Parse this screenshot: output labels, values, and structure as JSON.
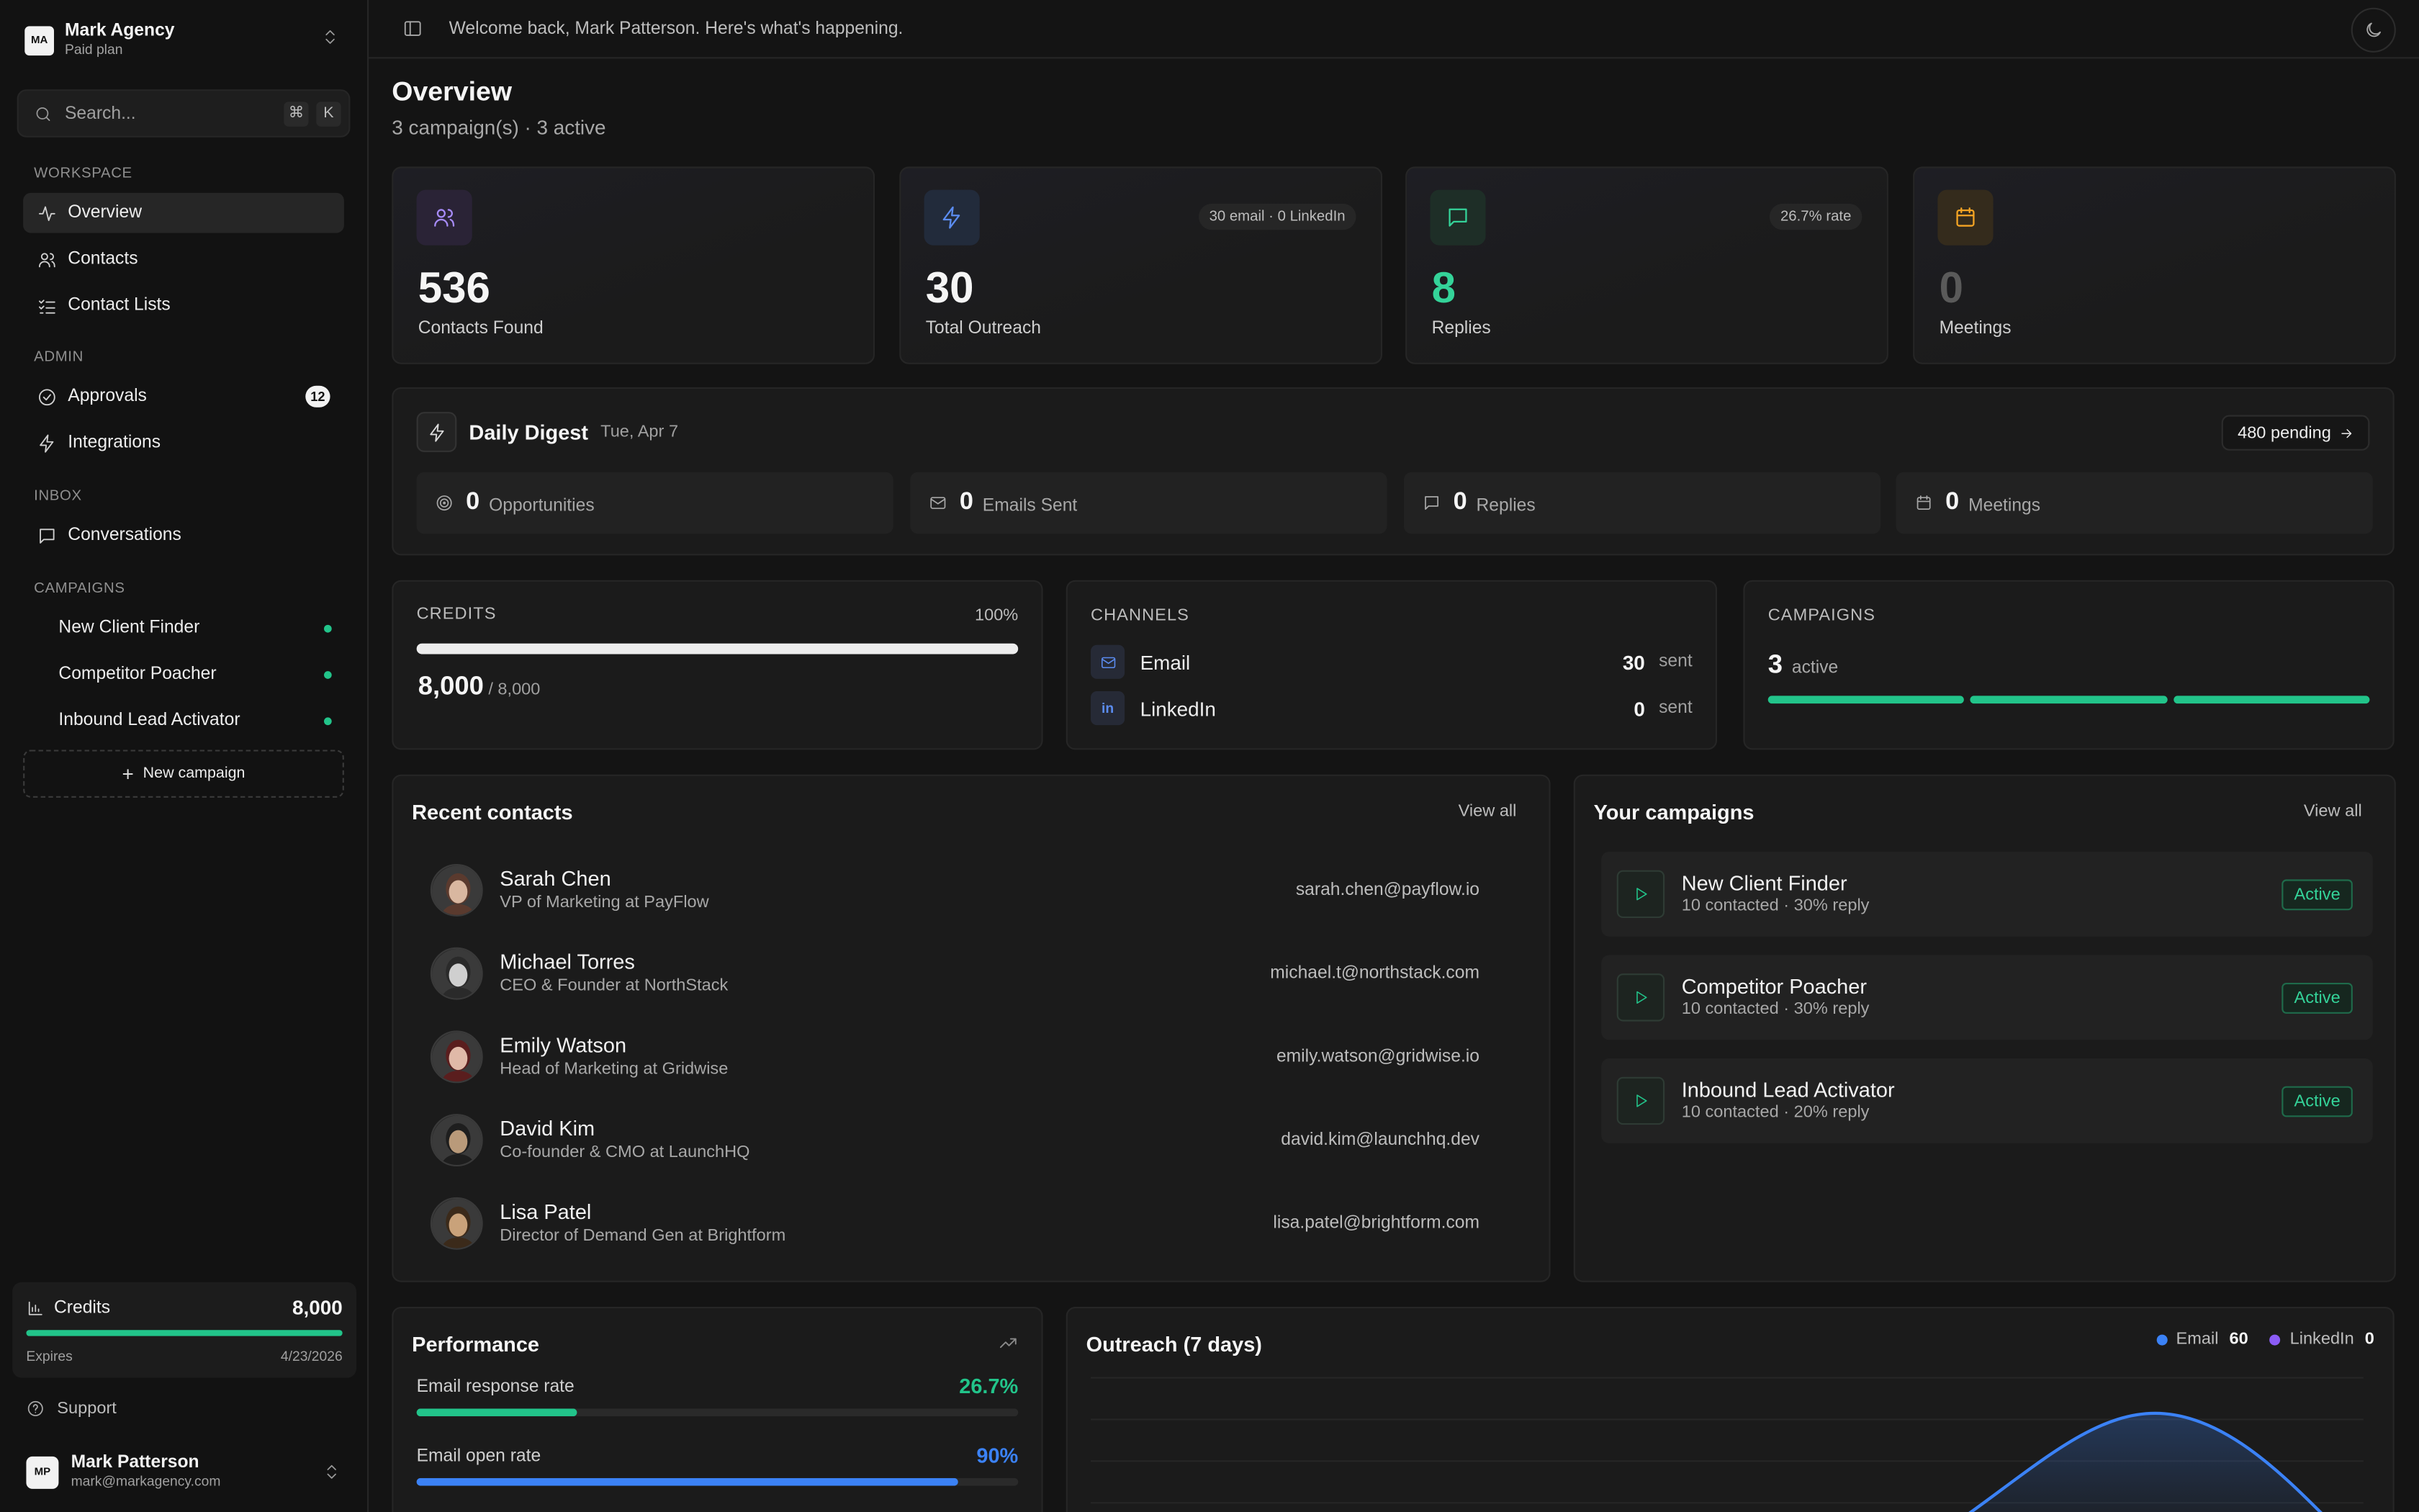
{
  "org": {
    "initials": "MA",
    "name": "Mark Agency",
    "plan": "Paid plan"
  },
  "search": {
    "placeholder": "Search...",
    "shortcut_mod": "⌘",
    "shortcut_key": "K"
  },
  "sidebar": {
    "workspace_label": "WORKSPACE",
    "workspace": [
      {
        "label": "Overview",
        "icon": "activity-icon"
      },
      {
        "label": "Contacts",
        "icon": "users-icon"
      },
      {
        "label": "Contact Lists",
        "icon": "list-checks-icon"
      }
    ],
    "admin_label": "ADMIN",
    "admin": [
      {
        "label": "Approvals",
        "icon": "check-circle-icon",
        "badge": "12"
      },
      {
        "label": "Integrations",
        "icon": "bolt-icon"
      }
    ],
    "inbox_label": "INBOX",
    "inbox": [
      {
        "label": "Conversations",
        "icon": "message-icon"
      }
    ],
    "campaigns_label": "CAMPAIGNS",
    "campaigns": [
      {
        "label": "New Client Finder"
      },
      {
        "label": "Competitor Poacher"
      },
      {
        "label": "Inbound Lead Activator"
      }
    ],
    "new_campaign": "New campaign",
    "credits": {
      "title": "Credits",
      "value": "8,000",
      "expires_label": "Expires",
      "expires_date": "4/23/2026",
      "fill": 1.0
    },
    "support": "Support",
    "user": {
      "initials": "MP",
      "name": "Mark Patterson",
      "email": "mark@markagency.com"
    }
  },
  "topbar": {
    "welcome": "Welcome back, Mark Patterson. Here's what's happening."
  },
  "page": {
    "title": "Overview",
    "subtitle": "3 campaign(s) · 3 active"
  },
  "stats": [
    {
      "value": "536",
      "label": "Contacts Found",
      "pill": "",
      "color": "#f5f5f5",
      "icon_bg": "#2a2336",
      "icon_color": "#a78bfa"
    },
    {
      "value": "30",
      "label": "Total Outreach",
      "pill": "30 email · 0 LinkedIn",
      "color": "#f5f5f5",
      "icon_bg": "#222b3b",
      "icon_color": "#5b8cf0"
    },
    {
      "value": "8",
      "label": "Replies",
      "pill": "26.7% rate",
      "color": "#34d399",
      "icon_bg": "#1e2e27",
      "icon_color": "#34d399"
    },
    {
      "value": "0",
      "label": "Meetings",
      "pill": "",
      "color": "#5a5a5a",
      "icon_bg": "#342b1c",
      "icon_color": "#f5a524"
    }
  ],
  "digest": {
    "title": "Daily Digest",
    "date": "Tue, Apr 7",
    "pending": "480 pending",
    "tiles": [
      {
        "num": "0",
        "label": "Opportunities",
        "icon": "target-icon"
      },
      {
        "num": "0",
        "label": "Emails Sent",
        "icon": "mail-icon"
      },
      {
        "num": "0",
        "label": "Replies",
        "icon": "message-icon"
      },
      {
        "num": "0",
        "label": "Meetings",
        "icon": "calendar-icon"
      }
    ]
  },
  "credits_card": {
    "label": "CREDITS",
    "pct": "100%",
    "value": "8,000",
    "total": "/ 8,000",
    "fill": 1.0
  },
  "channels": {
    "label": "CHANNELS",
    "rows": [
      {
        "name": "Email",
        "num": "30",
        "unit": "sent"
      },
      {
        "name": "LinkedIn",
        "num": "0",
        "unit": "sent"
      }
    ]
  },
  "campaigns_card": {
    "label": "CAMPAIGNS",
    "count": "3",
    "status": "active"
  },
  "recent": {
    "title": "Recent contacts",
    "view_all": "View all",
    "contacts": [
      {
        "name": "Sarah Chen",
        "role": "VP of Marketing at PayFlow",
        "email": "sarah.chen@payflow.io",
        "hair": "#5a3a2e",
        "skin": "#d9b7a0"
      },
      {
        "name": "Michael Torres",
        "role": "CEO & Founder at NorthStack",
        "email": "michael.t@northstack.com",
        "hair": "#2a2a2a",
        "skin": "#cfcfcf"
      },
      {
        "name": "Emily Watson",
        "role": "Head of Marketing at Gridwise",
        "email": "emily.watson@gridwise.io",
        "hair": "#5a1e1e",
        "skin": "#e0b9a8"
      },
      {
        "name": "David Kim",
        "role": "Co-founder & CMO at LaunchHQ",
        "email": "david.kim@launchhq.dev",
        "hair": "#1e1e1e",
        "skin": "#b99a7a"
      },
      {
        "name": "Lisa Patel",
        "role": "Director of Demand Gen at Brightform",
        "email": "lisa.patel@brightform.com",
        "hair": "#3b2a1a",
        "skin": "#c9a27a"
      }
    ]
  },
  "your_campaigns": {
    "title": "Your campaigns",
    "view_all": "View all",
    "items": [
      {
        "name": "New Client Finder",
        "meta": "10 contacted · 30% reply",
        "status": "Active"
      },
      {
        "name": "Competitor Poacher",
        "meta": "10 contacted · 30% reply",
        "status": "Active"
      },
      {
        "name": "Inbound Lead Activator",
        "meta": "10 contacted · 20% reply",
        "status": "Active"
      }
    ]
  },
  "performance": {
    "title": "Performance",
    "metrics": [
      {
        "name": "Email response rate",
        "value": "26.7%",
        "fill": 0.267,
        "color": "#22c48a"
      },
      {
        "name": "Email open rate",
        "value": "90%",
        "fill": 0.9,
        "color": "#3b82f6"
      }
    ]
  },
  "outreach": {
    "title": "Outreach (7 days)",
    "legend": [
      {
        "name": "Email",
        "value": "60",
        "color": "#3b82f6"
      },
      {
        "name": "LinkedIn",
        "value": "0",
        "color": "#8b5cf6"
      }
    ]
  }
}
